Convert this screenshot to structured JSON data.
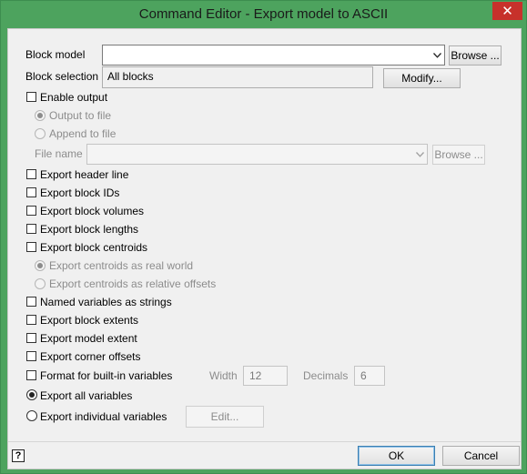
{
  "window": {
    "title": "Command Editor - Export model to ASCII",
    "close_glyph": "✕"
  },
  "block_model": {
    "label": "Block model",
    "value": "",
    "browse_label": "Browse ..."
  },
  "block_selection": {
    "label": "Block selection",
    "value": "All blocks",
    "modify_label": "Modify..."
  },
  "output": {
    "enable_label": "Enable output",
    "output_to_file_label": "Output to file",
    "append_to_file_label": "Append to file",
    "file_name_label": "File name",
    "file_name_value": "",
    "browse_label": "Browse ..."
  },
  "options": {
    "export_header_line": "Export header line",
    "export_block_ids": "Export block IDs",
    "export_block_volumes": "Export block volumes",
    "export_block_lengths": "Export block lengths",
    "export_block_centroids": "Export block centroids",
    "centroids_real_world": "Export centroids as real world",
    "centroids_relative_offsets": "Export centroids as relative offsets",
    "named_variables_as_strings": "Named variables as strings",
    "export_block_extents": "Export block extents",
    "export_model_extent": "Export model extent",
    "export_corner_offsets": "Export corner offsets",
    "format_builtin_variables": "Format for built-in variables",
    "width_label": "Width",
    "width_value": "12",
    "decimals_label": "Decimals",
    "decimals_value": "6",
    "export_all_variables": "Export all variables",
    "export_individual_variables": "Export individual variables",
    "edit_label": "Edit..."
  },
  "footer": {
    "help_glyph": "?",
    "ok_label": "OK",
    "cancel_label": "Cancel"
  },
  "colors": {
    "frame": "#4da35e",
    "close": "#c7312b",
    "client": "#f0f0f0"
  }
}
